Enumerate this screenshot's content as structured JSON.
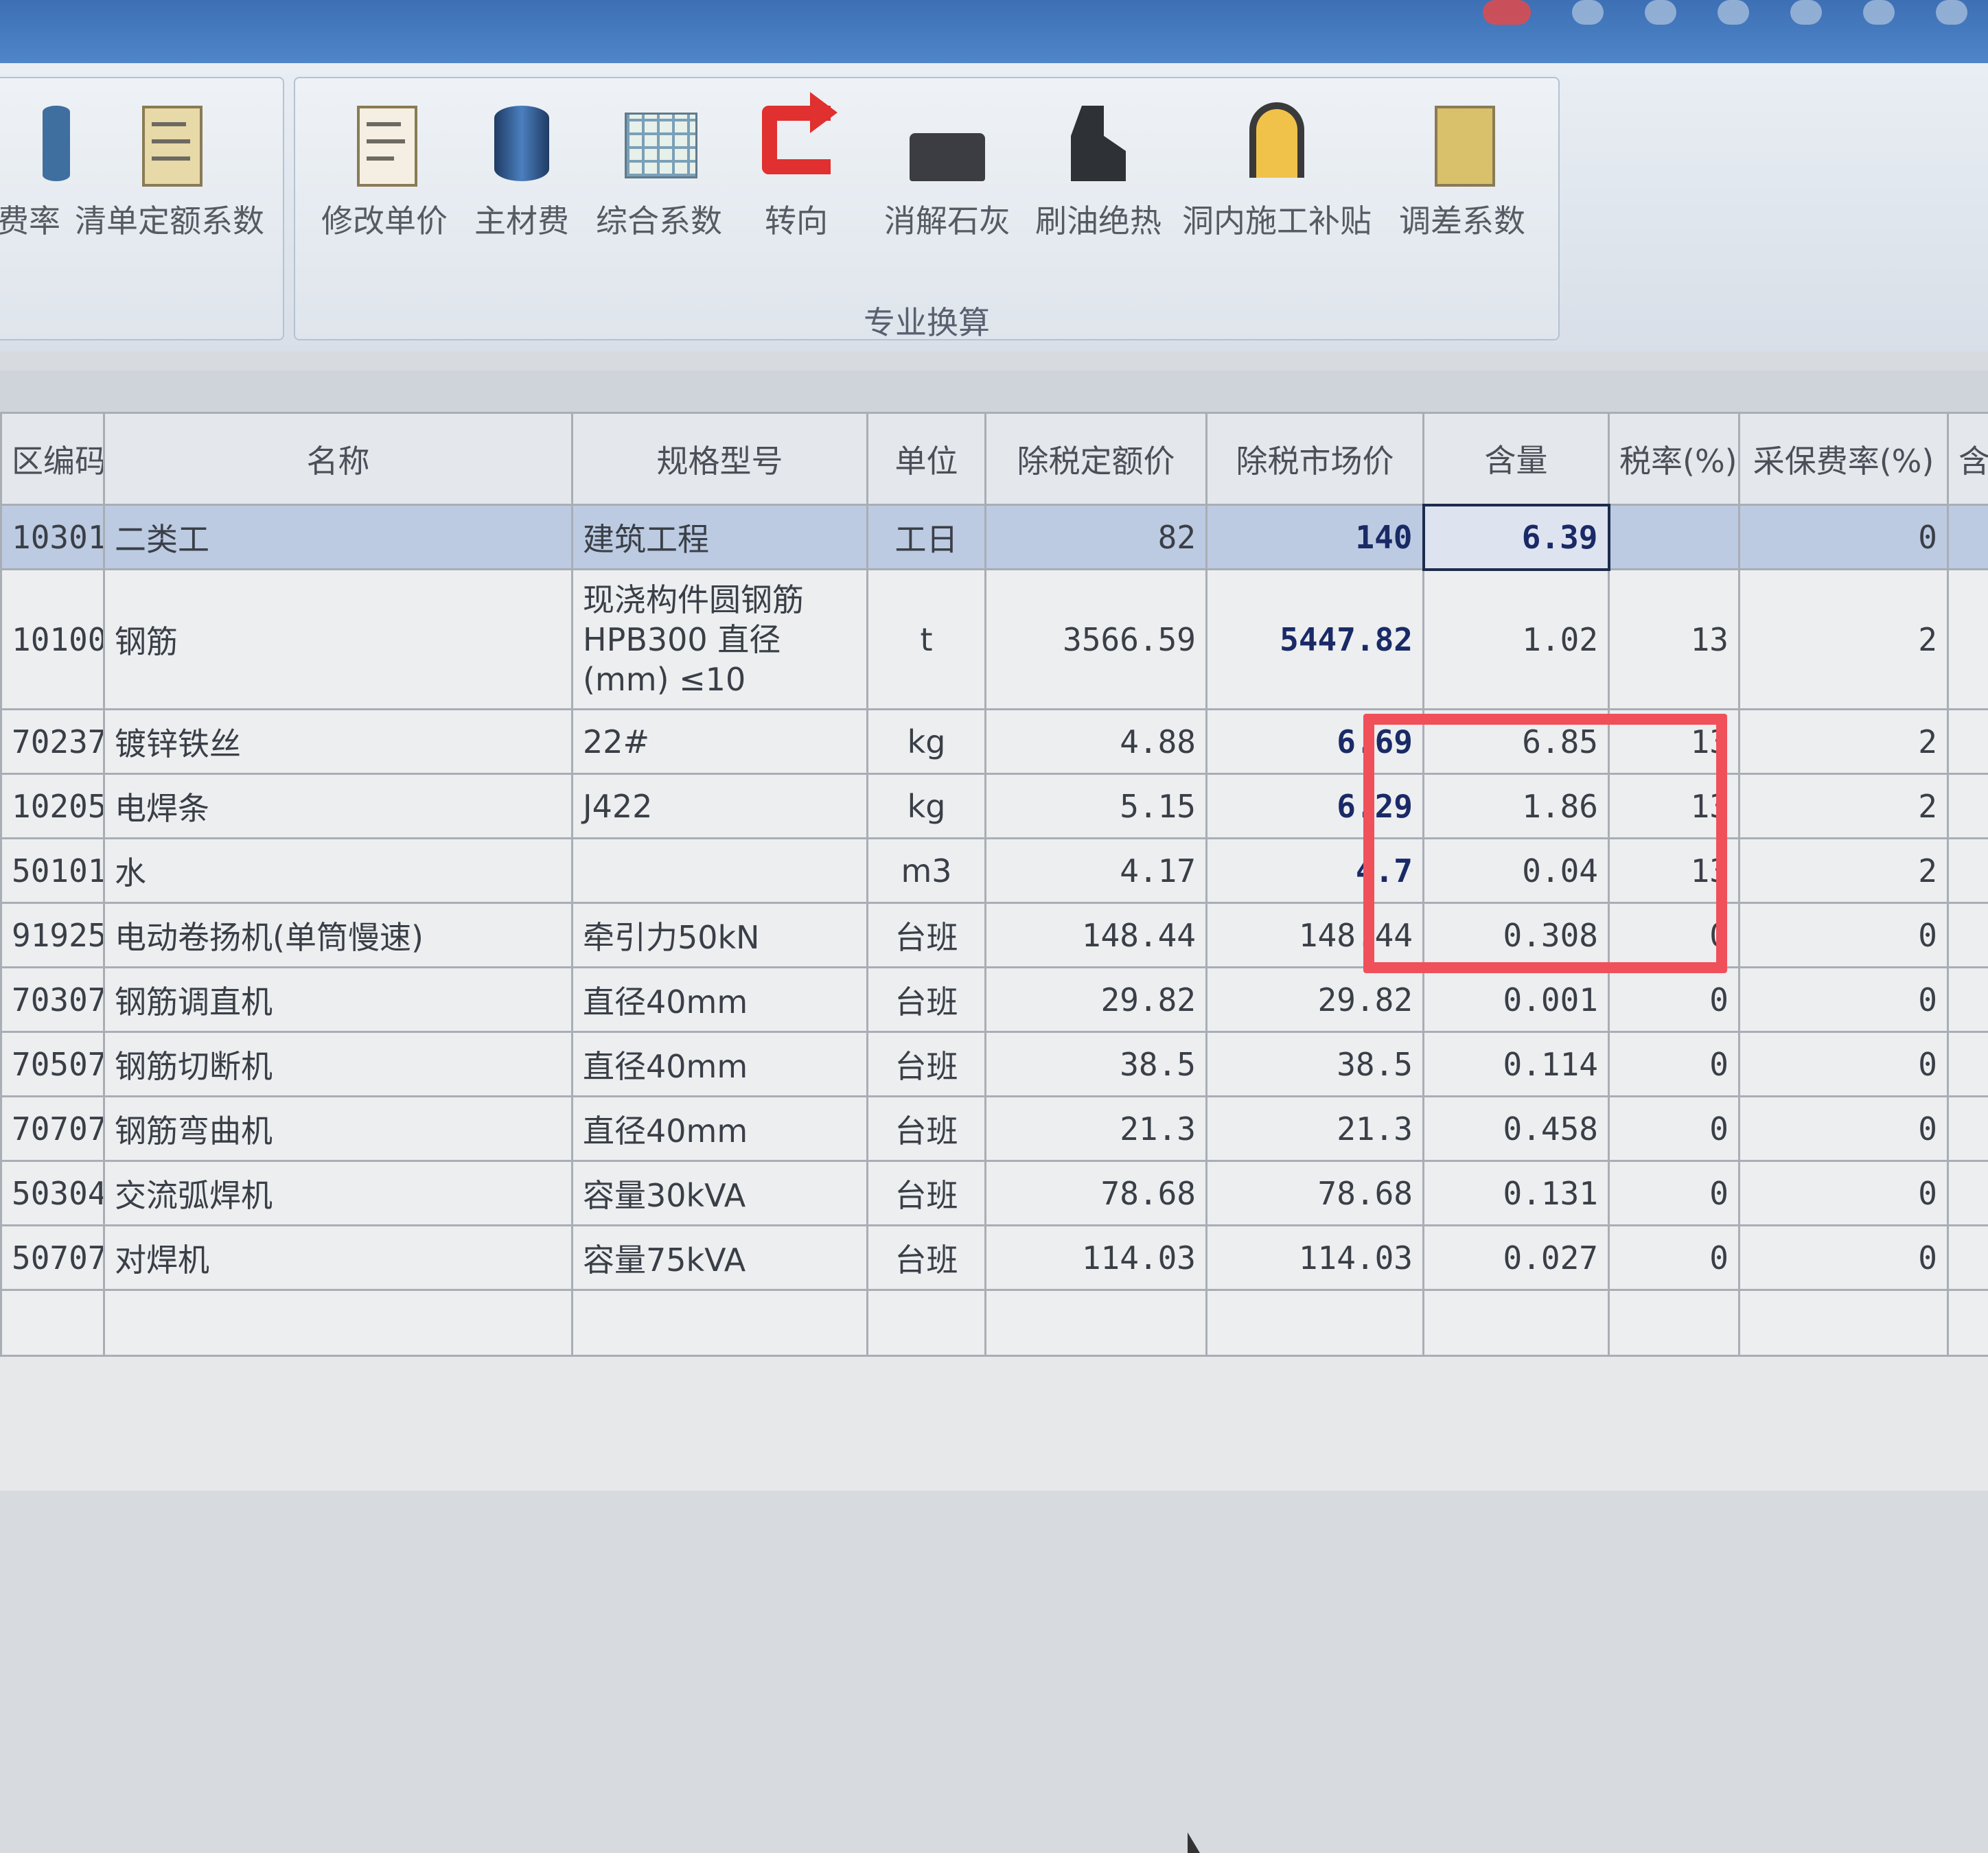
{
  "ribbon": {
    "group1": {
      "tools": [
        "费率",
        "清单定额系数"
      ]
    },
    "group2": {
      "label": "专业换算",
      "tools": [
        "修改单价",
        "主材费",
        "综合系数",
        "转向",
        "消解石灰",
        "刷油绝热",
        "洞内施工补贴",
        "调差系数"
      ]
    }
  },
  "table": {
    "headers": [
      "区编码",
      "名称",
      "规格型号",
      "单位",
      "除税定额价",
      "除税市场价",
      "含量",
      "税率(%)",
      "采保费率(%)",
      "含"
    ],
    "rows": [
      {
        "code": "10301",
        "name": "二类工",
        "spec": "建筑工程",
        "unit": "工日",
        "base_price": "82",
        "market_price": "140",
        "qty": "6.39",
        "tax": "",
        "fee": "0"
      },
      {
        "code": "10100",
        "name": "钢筋",
        "spec": "现浇构件圆钢筋HPB300 直径(mm) ≤10",
        "unit": "t",
        "base_price": "3566.59",
        "market_price": "5447.82",
        "qty": "1.02",
        "tax": "13",
        "fee": "2"
      },
      {
        "code": "70237",
        "name": "镀锌铁丝",
        "spec": "22#",
        "unit": "kg",
        "base_price": "4.88",
        "market_price": "6.69",
        "qty": "6.85",
        "tax": "13",
        "fee": "2"
      },
      {
        "code": "10205",
        "name": "电焊条",
        "spec": "J422",
        "unit": "kg",
        "base_price": "5.15",
        "market_price": "6.29",
        "qty": "1.86",
        "tax": "13",
        "fee": "2"
      },
      {
        "code": "50101",
        "name": "水",
        "spec": "",
        "unit": "m3",
        "base_price": "4.17",
        "market_price": "4.7",
        "qty": "0.04",
        "tax": "13",
        "fee": "2"
      },
      {
        "code": "91925",
        "name": "电动卷扬机(单筒慢速)",
        "spec": "牵引力50kN",
        "unit": "台班",
        "base_price": "148.44",
        "market_price": "148.44",
        "qty": "0.308",
        "tax": "0",
        "fee": "0"
      },
      {
        "code": "70307",
        "name": "钢筋调直机",
        "spec": "直径40mm",
        "unit": "台班",
        "base_price": "29.82",
        "market_price": "29.82",
        "qty": "0.001",
        "tax": "0",
        "fee": "0"
      },
      {
        "code": "70507",
        "name": "钢筋切断机",
        "spec": "直径40mm",
        "unit": "台班",
        "base_price": "38.5",
        "market_price": "38.5",
        "qty": "0.114",
        "tax": "0",
        "fee": "0"
      },
      {
        "code": "70707",
        "name": "钢筋弯曲机",
        "spec": "直径40mm",
        "unit": "台班",
        "base_price": "21.3",
        "market_price": "21.3",
        "qty": "0.458",
        "tax": "0",
        "fee": "0"
      },
      {
        "code": "50304",
        "name": "交流弧焊机",
        "spec": "容量30kVA",
        "unit": "台班",
        "base_price": "78.68",
        "market_price": "78.68",
        "qty": "0.131",
        "tax": "0",
        "fee": "0"
      },
      {
        "code": "50707",
        "name": "对焊机",
        "spec": "容量75kVA",
        "unit": "台班",
        "base_price": "114.03",
        "market_price": "114.03",
        "qty": "0.027",
        "tax": "0",
        "fee": "0"
      }
    ]
  },
  "colors": {
    "highlight": "#f0505a",
    "selected_row": "#bccbe2",
    "bold_value": "#1a2a66"
  }
}
